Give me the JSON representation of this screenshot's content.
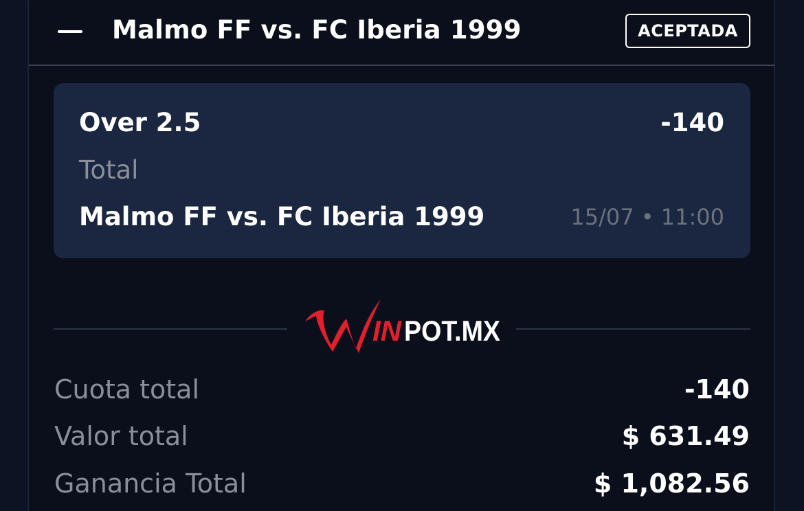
{
  "header": {
    "title": "Malmo FF vs. FC Iberia 1999",
    "status": "ACEPTADA"
  },
  "selection": {
    "name": "Over 2.5",
    "odds": "-140",
    "market": "Total",
    "event": "Malmo FF vs. FC Iberia 1999",
    "datetime": "15/07 • 11:00"
  },
  "logo": {
    "text_w": "W",
    "text_in": "IN",
    "text_pot": "POT.MX",
    "colors": {
      "red": "#e21f2d",
      "white": "#ffffff"
    }
  },
  "summary": {
    "rows": [
      {
        "label": "Cuota total",
        "value": "-140"
      },
      {
        "label": "Valor total",
        "value": "$ 631.49"
      },
      {
        "label": "Ganancia Total",
        "value": "$ 1,082.56"
      }
    ]
  },
  "colors": {
    "background": "#0d1322",
    "card": "#0a0f1b",
    "selection_box": "#1b2740",
    "muted_text": "#8a8f99",
    "brand_red": "#e21f2d"
  }
}
